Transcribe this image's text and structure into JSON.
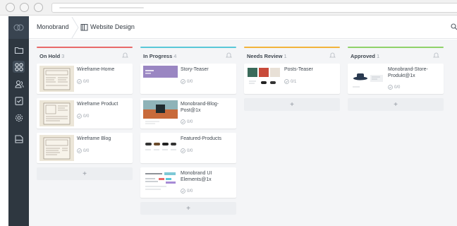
{
  "header": {
    "workspace": "Monobrand",
    "project": "Website Design"
  },
  "colors": {
    "on_hold": "#e86a6a",
    "in_progress": "#5ac8d8",
    "needs_review": "#f2b43c",
    "approved": "#8fd26a",
    "sidebar": "#2e3740"
  },
  "sidebar": {
    "items": [
      {
        "icon": "folder-icon"
      },
      {
        "icon": "board-icon"
      },
      {
        "icon": "users-icon"
      },
      {
        "icon": "checklist-icon"
      },
      {
        "icon": "settings-icon"
      },
      {
        "icon": "archive-icon"
      }
    ]
  },
  "columns": [
    {
      "title": "On Hold",
      "count": "3",
      "cards": [
        {
          "title": "Wireframe-Home",
          "meta": "0/0"
        },
        {
          "title": "Wireframe Product",
          "meta": "0/0"
        },
        {
          "title": "Wireframe Blog",
          "meta": "0/0"
        }
      ],
      "add": "+"
    },
    {
      "title": "In Progress",
      "count": "4",
      "cards": [
        {
          "title": "Story-Teaser",
          "meta": "0/0"
        },
        {
          "title": "Monobrand-Blog-Post@1x",
          "meta": "0/0"
        },
        {
          "title": "Featured-Products",
          "meta": "0/0"
        },
        {
          "title": "Monobrand UI Elements@1x",
          "meta": "0/0"
        }
      ],
      "add": "+"
    },
    {
      "title": "Needs Review",
      "count": "1",
      "cards": [
        {
          "title": "Posts-Teaser",
          "meta": "0/1"
        }
      ],
      "add": "+"
    },
    {
      "title": "Approved",
      "count": "1",
      "cards": [
        {
          "title": "Monobrand-Store-Produkt@1x",
          "meta": "0/0"
        }
      ],
      "add": "+"
    }
  ]
}
